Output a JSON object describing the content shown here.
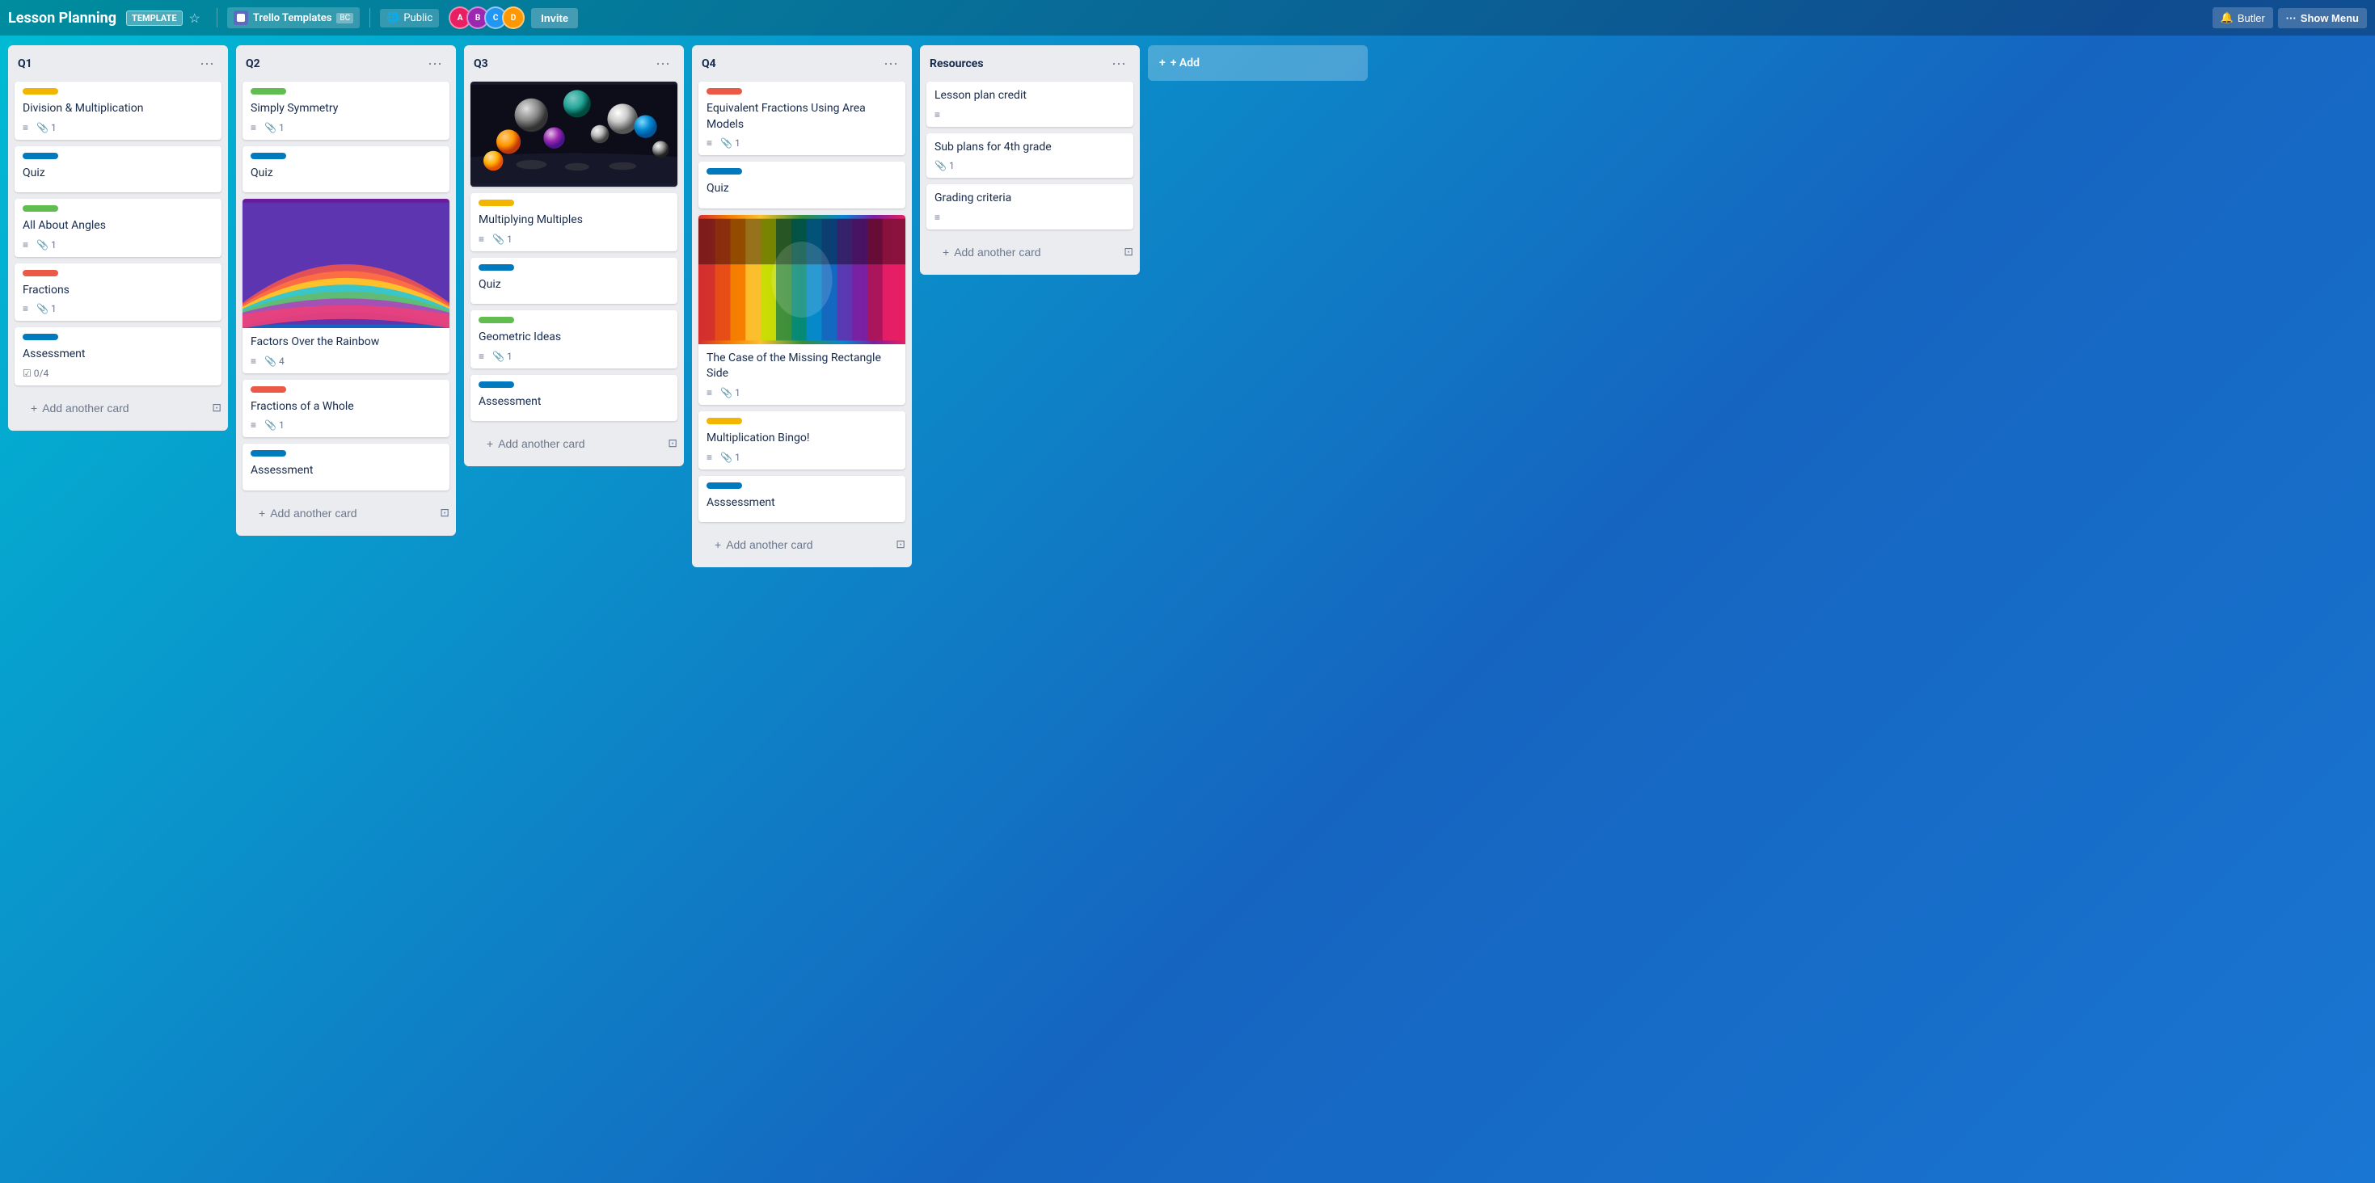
{
  "header": {
    "title": "Lesson Planning",
    "template_badge": "TEMPLATE",
    "workspace_name": "Trello Templates",
    "workspace_badge": "BC",
    "visibility": "Public",
    "invite_label": "Invite",
    "butler_label": "Butler",
    "show_menu_label": "Show Menu",
    "avatars": [
      "A",
      "B",
      "C",
      "D"
    ]
  },
  "columns": [
    {
      "id": "q1",
      "title": "Q1",
      "cards": [
        {
          "id": "div-mult",
          "label_color": "label-yellow",
          "title": "Division & Multiplication",
          "has_desc": true,
          "attachment_count": "1"
        },
        {
          "id": "quiz-q1",
          "label_color": "label-blue",
          "title": "Quiz",
          "has_desc": false,
          "attachment_count": null
        },
        {
          "id": "all-angles",
          "label_color": "label-green",
          "title": "All About Angles",
          "has_desc": true,
          "attachment_count": "1"
        },
        {
          "id": "fractions-q1",
          "label_color": "label-red",
          "title": "Fractions",
          "has_desc": true,
          "attachment_count": "1"
        },
        {
          "id": "assessment-q1",
          "label_color": "label-blue",
          "title": "Assessment",
          "has_desc": false,
          "attachment_count": null,
          "checklist": "0/4"
        }
      ],
      "add_card_label": "Add another card"
    },
    {
      "id": "q2",
      "title": "Q2",
      "cards": [
        {
          "id": "simply-symmetry",
          "label_color": "label-green",
          "title": "Simply Symmetry",
          "has_desc": true,
          "attachment_count": "1"
        },
        {
          "id": "quiz-q2",
          "label_color": "label-blue",
          "title": "Quiz",
          "has_desc": false,
          "attachment_count": null
        },
        {
          "id": "factors-rainbow",
          "label_color": null,
          "title": "Factors Over the Rainbow",
          "has_desc": true,
          "attachment_count": "4",
          "has_image": "rainbow"
        },
        {
          "id": "fractions-whole",
          "label_color": "label-red",
          "title": "Fractions of a Whole",
          "has_desc": true,
          "attachment_count": "1"
        },
        {
          "id": "assessment-q2",
          "label_color": "label-blue",
          "title": "Assessment",
          "has_desc": false,
          "attachment_count": null
        }
      ],
      "add_card_label": "Add another card"
    },
    {
      "id": "q3",
      "title": "Q3",
      "cards": [
        {
          "id": "spheres-card",
          "label_color": null,
          "title": null,
          "has_desc": false,
          "attachment_count": null,
          "has_image": "spheres"
        },
        {
          "id": "multiplying-multiples",
          "label_color": "label-yellow",
          "title": "Multiplying Multiples",
          "has_desc": true,
          "attachment_count": "1"
        },
        {
          "id": "quiz-q3",
          "label_color": "label-blue",
          "title": "Quiz",
          "has_desc": false,
          "attachment_count": null
        },
        {
          "id": "geometric-ideas",
          "label_color": "label-green",
          "title": "Geometric Ideas",
          "has_desc": true,
          "attachment_count": "1"
        },
        {
          "id": "assessment-q3",
          "label_color": "label-blue",
          "title": "Assessment",
          "has_desc": false,
          "attachment_count": null
        }
      ],
      "add_card_label": "Add another card"
    },
    {
      "id": "q4",
      "title": "Q4",
      "cards": [
        {
          "id": "equiv-fractions",
          "label_color": "label-red",
          "title": "Equivalent Fractions Using Area Models",
          "has_desc": true,
          "attachment_count": "1"
        },
        {
          "id": "quiz-q4",
          "label_color": "label-blue",
          "title": "Quiz",
          "has_desc": false,
          "attachment_count": null
        },
        {
          "id": "missing-rectangle",
          "label_color": null,
          "title": "The Case of the Missing Rectangle Side",
          "has_desc": true,
          "attachment_count": "1",
          "has_image": "corridor"
        },
        {
          "id": "mult-bingo",
          "label_color": "label-yellow",
          "title": "Multiplication Bingo!",
          "has_desc": true,
          "attachment_count": "1"
        },
        {
          "id": "assessment-q4",
          "label_color": "label-blue",
          "title": "Asssessment",
          "has_desc": false,
          "attachment_count": null
        }
      ],
      "add_card_label": "Add another card"
    },
    {
      "id": "resources",
      "title": "Resources",
      "cards": [
        {
          "id": "lesson-plan-credit",
          "label_color": null,
          "title": "Lesson plan credit",
          "has_desc": true,
          "attachment_count": null
        },
        {
          "id": "sub-plans",
          "label_color": null,
          "title": "Sub plans for 4th grade",
          "has_desc": false,
          "attachment_count": "1"
        },
        {
          "id": "grading-criteria",
          "label_color": null,
          "title": "Grading criteria",
          "has_desc": true,
          "attachment_count": null
        }
      ],
      "add_card_label": "Add another card"
    }
  ],
  "add_column_label": "+ Add"
}
